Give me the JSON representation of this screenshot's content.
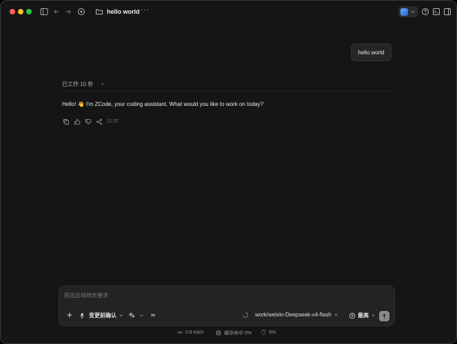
{
  "window": {
    "title": "hello world",
    "more_label": "···"
  },
  "chat": {
    "user_message": "hello world",
    "work_status": "已工作 10 秒",
    "assistant_message": "Hello! 👋 I'm ZCode, your coding assistant. What would you like to work on today?",
    "timestamp": "11:37"
  },
  "composer": {
    "placeholder": "提出后续修改要求",
    "confirm_mode": "变更前确认",
    "model": "work/weixin-Deepseek-v4-flash",
    "effort": "最高"
  },
  "status_bar": {
    "speed": "0.8 tok/s",
    "cache": "缓存命中 0%",
    "context": "9%"
  },
  "colors": {
    "close": "#ff5f57",
    "minimize": "#febc2e",
    "maximize": "#28c840",
    "background": "#151515"
  }
}
